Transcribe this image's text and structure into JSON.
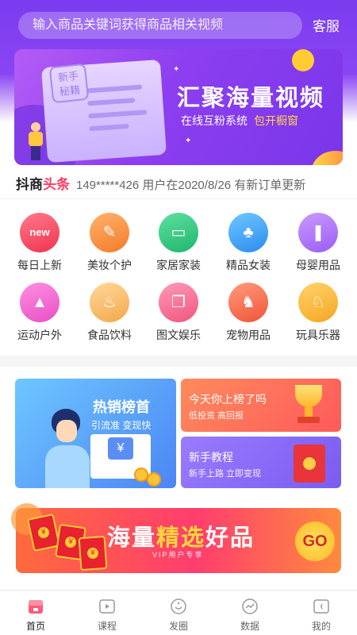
{
  "search": {
    "placeholder": "输入商品关键词获得商品相关视频"
  },
  "header": {
    "service_label": "客服"
  },
  "banner": {
    "badge_line1": "新手",
    "badge_line2": "秘籍",
    "title": "汇聚海量视频",
    "subtitle": "在线互粉系统",
    "subtitle_highlight": "包开橱窗"
  },
  "ticker": {
    "brand": "抖商",
    "brand_highlight": "头条",
    "message": "149*****426 用户在2020/8/26 有新订单更新"
  },
  "categories": [
    {
      "label": "每日上新",
      "icon": "new-badge-icon",
      "glyph": "new",
      "color_from": "#ff7a8a",
      "color_to": "#f0334f"
    },
    {
      "label": "美妆个护",
      "icon": "cosmetics-icon",
      "glyph": "✎",
      "color_from": "#ffb36b",
      "color_to": "#f57a2a"
    },
    {
      "label": "家居家装",
      "icon": "sofa-icon",
      "glyph": "▭",
      "color_from": "#5fe0a0",
      "color_to": "#1fb66e"
    },
    {
      "label": "精品女装",
      "icon": "dress-icon",
      "glyph": "♣",
      "color_from": "#6fc8ff",
      "color_to": "#2a8cf0"
    },
    {
      "label": "母婴用品",
      "icon": "baby-bottle-icon",
      "glyph": "❚",
      "color_from": "#c99bff",
      "color_to": "#9a5cf5"
    },
    {
      "label": "运动户外",
      "icon": "tent-icon",
      "glyph": "▲",
      "color_from": "#ff8fe0",
      "color_to": "#e84fc6"
    },
    {
      "label": "食品饮料",
      "icon": "cake-icon",
      "glyph": "♨",
      "color_from": "#ffd89a",
      "color_to": "#f3a84a"
    },
    {
      "label": "图文娱乐",
      "icon": "book-icon",
      "glyph": "❐",
      "color_from": "#ff9ab8",
      "color_to": "#f0557e"
    },
    {
      "label": "宠物用品",
      "icon": "dog-icon",
      "glyph": "♞",
      "color_from": "#ff9a7a",
      "color_to": "#f0553a"
    },
    {
      "label": "玩具乐器",
      "icon": "rocking-horse-icon",
      "glyph": "♘",
      "color_from": "#ffd36b",
      "color_to": "#f5a623"
    }
  ],
  "promo": {
    "big": {
      "title": "热销榜首",
      "subtitle": "引流准 变现快",
      "currency": "¥"
    },
    "right_top": {
      "title": "今天你上榜了吗",
      "subtitle": "低投资 高回报"
    },
    "right_bottom": {
      "title": "新手教程",
      "subtitle": "新手上路 立即变现"
    }
  },
  "bottom_banner": {
    "part1": "海量",
    "part2": "精选",
    "part3": "好品",
    "vip_text": "VIP用户专享",
    "go_label": "GO",
    "currency": "¥"
  },
  "tabbar": [
    {
      "label": "首页",
      "icon": "home-icon",
      "active": true
    },
    {
      "label": "课程",
      "icon": "play-video-icon",
      "active": false
    },
    {
      "label": "发圈",
      "icon": "smile-circle-icon",
      "active": false
    },
    {
      "label": "数据",
      "icon": "chart-line-icon",
      "active": false
    },
    {
      "label": "我的",
      "icon": "profile-icon",
      "active": false
    }
  ],
  "colors": {
    "brand_purple": "#7a3cf0",
    "accent_red": "#ff3b62",
    "accent_gold": "#ffd54a"
  }
}
